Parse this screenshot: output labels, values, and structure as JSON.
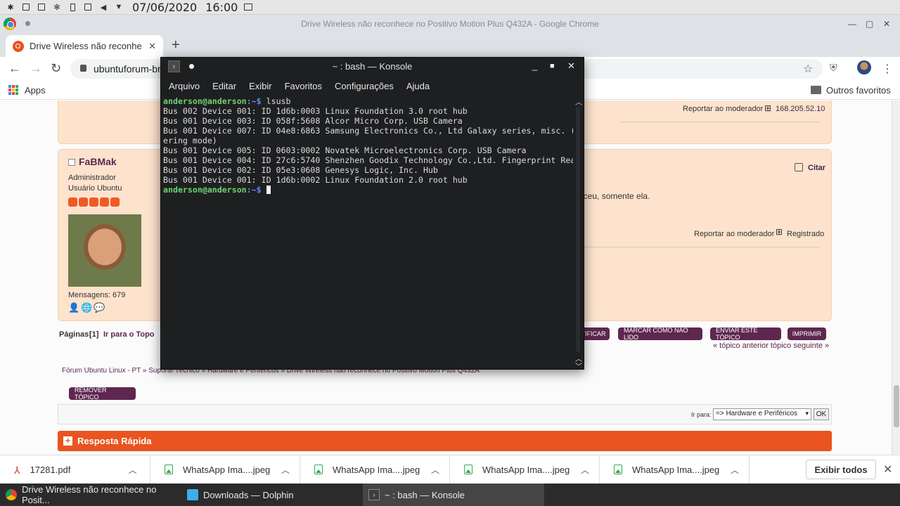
{
  "system_panel": {
    "date": "07/06/2020",
    "time": "16:00"
  },
  "chrome": {
    "window_title": "Drive Wireless não reconhece no Positivo Motion Plus Q432A - Google Chrome",
    "tab_title": "Drive Wireless não reconhece",
    "url": "ubuntuforum-br",
    "bookmarks": {
      "apps": "Apps",
      "other": "Outros favoritos"
    }
  },
  "page": {
    "top_post": {
      "report": "Reportar ao moderador",
      "ip": "168.205.52.10"
    },
    "post": {
      "username": "FaBMak",
      "role": "Administrador",
      "subrole": "Usuário Ubuntu",
      "messages": "Mensagens: 679",
      "quote": "Citar",
      "body_fragment": "eceu, somente ela.",
      "report": "Reportar ao moderador",
      "registered": "Registrado"
    },
    "pagination": {
      "label": "Páginas:",
      "current": "[1]",
      "go_top": "Ir para o Topo"
    },
    "action_buttons": [
      "TIFICAR",
      "MARCAR COMO NÃO LIDO",
      "ENVIAR ESTE TÓPICO",
      "IMPRIMIR"
    ],
    "topic_nav": "« tópico anterior tópico seguinte »",
    "breadcrumb": "Fórum Ubuntu Linux - PT »  Suporte Técnico »  Hardware e Periféricos »  Drive Wireless não reconhece no Positivo Motion Plus Q432A",
    "remove_topic": "REMOVER TÓPICO",
    "jump": {
      "label": "Ir para:",
      "selected": "=> Hardware e Periféricos",
      "ok": "OK"
    },
    "quick_reply": "Resposta Rápida"
  },
  "downloads": {
    "items": [
      {
        "name": "17281.pdf",
        "type": "pdf"
      },
      {
        "name": "WhatsApp Ima....jpeg",
        "type": "image"
      },
      {
        "name": "WhatsApp Ima....jpeg",
        "type": "image"
      },
      {
        "name": "WhatsApp Ima....jpeg",
        "type": "image"
      },
      {
        "name": "WhatsApp Ima....jpeg",
        "type": "image"
      }
    ],
    "show_all": "Exibir todos"
  },
  "taskbar": {
    "tasks": [
      {
        "label": "Drive Wireless não reconhece no Posit...",
        "icon": "chrome-icon"
      },
      {
        "label": "Downloads — Dolphin",
        "icon": "folder-icon"
      },
      {
        "label": "~ : bash — Konsole",
        "icon": "konsole-icon"
      }
    ]
  },
  "konsole": {
    "title": "~ : bash — Konsole",
    "menu": [
      "Arquivo",
      "Editar",
      "Exibir",
      "Favoritos",
      "Configurações",
      "Ajuda"
    ],
    "prompt_user": "anderson@anderson",
    "prompt_path": ":~$",
    "command": " lsusb",
    "output": [
      "Bus 002 Device 001: ID 1d6b:0003 Linux Foundation 3.0 root hub",
      "Bus 001 Device 003: ID 058f:5608 Alcor Micro Corp. USB Camera",
      "Bus 001 Device 007: ID 04e8:6863 Samsung Electronics Co., Ltd Galaxy series, misc. (teth",
      "ering mode)",
      "Bus 001 Device 005: ID 0603:0002 Novatek Microelectronics Corp. USB Camera",
      "Bus 001 Device 004: ID 27c6:5740 Shenzhen Goodix Technology Co.,Ltd. Fingerprint Reader",
      "Bus 001 Device 002: ID 05e3:0608 Genesys Logic, Inc. Hub",
      "Bus 001 Device 001: ID 1d6b:0002 Linux Foundation 2.0 root hub"
    ]
  }
}
